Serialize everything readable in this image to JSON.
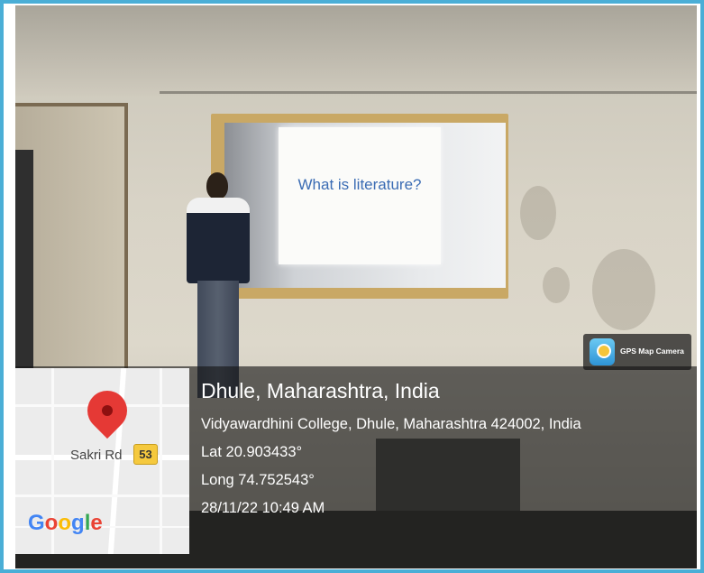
{
  "slide": {
    "text": "What is literature?"
  },
  "badge": {
    "app_name": "GPS Map Camera",
    "icon": "gps-map-camera-icon"
  },
  "map": {
    "road_label": "Sakri Rd",
    "route_number": "53",
    "logo_text": "Google",
    "pin_icon": "map-pin-icon"
  },
  "location": {
    "place": "Dhule, Maharashtra, India",
    "address": "Vidyawardhini College, Dhule, Maharashtra 424002, India",
    "latitude": "Lat 20.903433°",
    "longitude": "Long 74.752543°",
    "timestamp": "28/11/22 10:49 AM"
  },
  "colors": {
    "frame_border": "#4aaed6",
    "pin": "#e53935",
    "shield": "#f5c93e",
    "slide_text": "#3b6cb4"
  }
}
